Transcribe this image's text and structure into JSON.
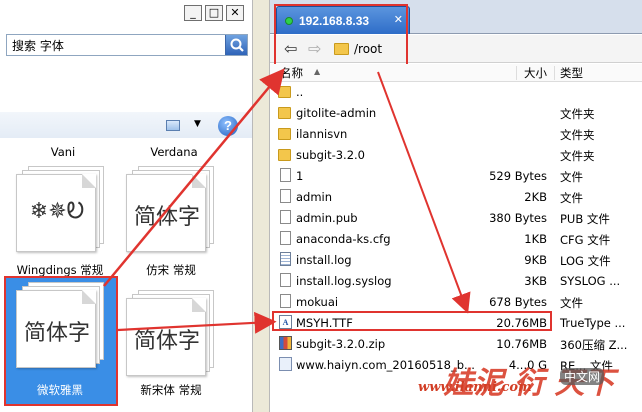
{
  "left_window": {
    "controls": {
      "minimize": "_",
      "maximize": "□",
      "close": "✕"
    },
    "search": {
      "value": "搜索 字体"
    },
    "toolbar": {
      "view_dropdown": "▼",
      "help": "?"
    },
    "fonts": [
      {
        "name": "Vani",
        "glyph": ""
      },
      {
        "name": "Verdana",
        "glyph": ""
      },
      {
        "name": "Wingdings 常规",
        "glyph": "❄✵Ꭷ"
      },
      {
        "name": "仿宋 常规",
        "glyph": "简体字"
      },
      {
        "name": "微软雅黑",
        "glyph": "简体字",
        "selected": true
      },
      {
        "name": "新宋体 常规",
        "glyph": "简体字"
      }
    ]
  },
  "sftp": {
    "tab": {
      "label": "192.168.8.33",
      "close": "✕"
    },
    "nav": {
      "back": "⇦",
      "forward": "⇨"
    },
    "path": "/root",
    "columns": {
      "name": "名称",
      "sort": "▲",
      "size": "大小",
      "type": "类型"
    },
    "files": [
      {
        "name": "..",
        "size": "",
        "type": "",
        "icon": "folder"
      },
      {
        "name": "gitolite-admin",
        "size": "",
        "type": "文件夹",
        "icon": "folder"
      },
      {
        "name": "ilannisvn",
        "size": "",
        "type": "文件夹",
        "icon": "folder"
      },
      {
        "name": "subgit-3.2.0",
        "size": "",
        "type": "文件夹",
        "icon": "folder"
      },
      {
        "name": "1",
        "size": "529 Bytes",
        "type": "文件",
        "icon": "file"
      },
      {
        "name": "admin",
        "size": "2KB",
        "type": "文件",
        "icon": "file"
      },
      {
        "name": "admin.pub",
        "size": "380 Bytes",
        "type": "PUB 文件",
        "icon": "file"
      },
      {
        "name": "anaconda-ks.cfg",
        "size": "1KB",
        "type": "CFG 文件",
        "icon": "file"
      },
      {
        "name": "install.log",
        "size": "9KB",
        "type": "LOG 文件",
        "icon": "text"
      },
      {
        "name": "install.log.syslog",
        "size": "3KB",
        "type": "SYSLOG ...",
        "icon": "file"
      },
      {
        "name": "mokuai",
        "size": "678 Bytes",
        "type": "文件",
        "icon": "file"
      },
      {
        "name": "MSYH.TTF",
        "size": "20.76MB",
        "type": "TrueType ...",
        "icon": "font",
        "highlighted": true
      },
      {
        "name": "subgit-3.2.0.zip",
        "size": "10.76MB",
        "type": "360压缩 Z...",
        "icon": "zip"
      },
      {
        "name": "www.haiyn.com_20160518_b...",
        "size": "4...0 G",
        "type": "RE... 文件",
        "icon": "web"
      }
    ]
  },
  "watermark": {
    "main": "娃泥 衍 天下",
    "url": "www.ilanni.com",
    "badge": "中文网"
  },
  "colors": {
    "highlight_red": "#e0342f",
    "tab_blue": "#2e6dc8",
    "selected_tile": "#3a8ee6"
  }
}
